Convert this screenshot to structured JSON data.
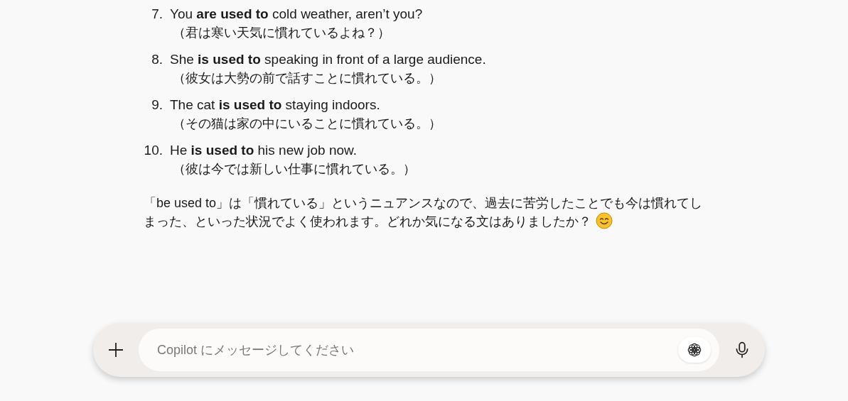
{
  "answer": {
    "items": [
      {
        "number": "7.",
        "sentence": "You **are used to** cold weather, aren’t you?",
        "translation": "（君は寒い天気に慣れているよね？）"
      },
      {
        "number": "8.",
        "sentence": "She **is used to** speaking in front of a large audience.",
        "translation": "（彼女は大勢の前で話すことに慣れている。）"
      },
      {
        "number": "9.",
        "sentence": "The cat **is used to** staying indoors.",
        "translation": "（その猫は家の中にいることに慣れている。）"
      },
      {
        "number": "10.",
        "sentence": "He **is used to** his new job now.",
        "translation": "（彼は今では新しい仕事に慣れている。）"
      }
    ],
    "closing": "「be used to」は「慣れている」というニュアンスなので、過去に苦労したことでも今は慣れてしまった、といった状況でよく使われます。どれか気になる文はありましたか？"
  },
  "composer": {
    "placeholder": "Copilot にメッセージしてください"
  }
}
